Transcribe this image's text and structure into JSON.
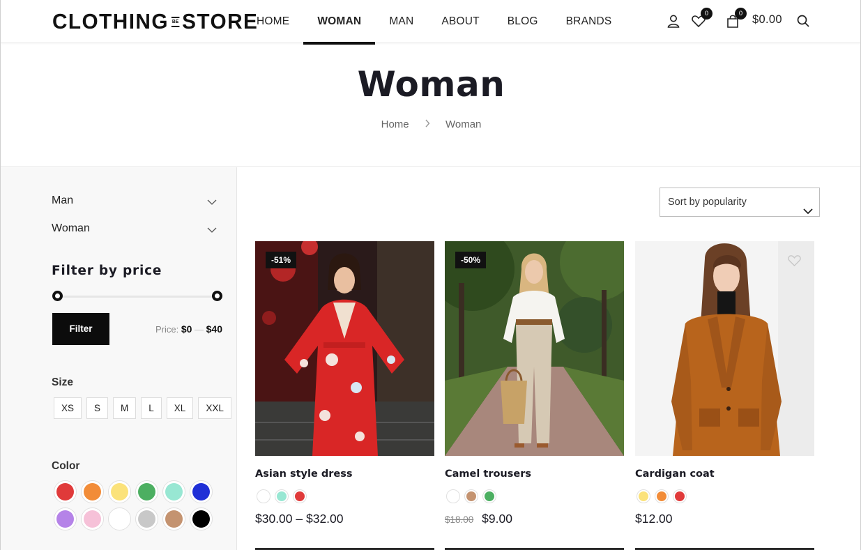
{
  "header": {
    "logo_left": "CLOTHING",
    "logo_mid": "BE",
    "logo_right": "STORE",
    "nav": [
      "HOME",
      "WOMAN",
      "MAN",
      "ABOUT",
      "BLOG",
      "BRANDS"
    ],
    "active_nav": "WOMAN",
    "icons": [
      "user-icon",
      "heart-icon",
      "cart-icon",
      "search-icon"
    ],
    "wishlist_count": "0",
    "cart_count": "0",
    "cart_total": "$0.00"
  },
  "page": {
    "title": "Woman",
    "breadcrumb": [
      "Home",
      "Woman"
    ]
  },
  "sidebar": {
    "categories": [
      "Man",
      "Woman"
    ],
    "price_heading": "Filter by price",
    "filter_label": "Filter",
    "price_prefix": "Price:",
    "price_min": "$0",
    "price_sep": "—",
    "price_max": "$40",
    "size_heading": "Size",
    "sizes": [
      "XS",
      "S",
      "M",
      "L",
      "XL",
      "XXL"
    ],
    "color_heading": "Color",
    "colors": [
      "#e03a3a",
      "#f28c38",
      "#fbe27a",
      "#4caf61",
      "#98e7d3",
      "#1f2fd6",
      "#b583e8",
      "#f6c1d8",
      "#ffffff",
      "#c8c8c8",
      "#c49370",
      "#000000"
    ]
  },
  "main": {
    "sort_label": "Sort by popularity",
    "products": [
      {
        "name": "Asian style dress",
        "sale": "-51%",
        "colors": [
          "#ffffff",
          "#98e7d3",
          "#e03a3a"
        ],
        "old_price": "",
        "price": "$30.00 – $32.00"
      },
      {
        "name": "Camel trousers",
        "sale": "-50%",
        "colors": [
          "#ffffff",
          "#c49370",
          "#4caf61"
        ],
        "old_price": "$18.00",
        "price": "$9.00"
      },
      {
        "name": "Cardigan coat",
        "sale": "",
        "colors": [
          "#fbe27a",
          "#f28c38",
          "#e03a3a"
        ],
        "old_price": "",
        "price": "$12.00"
      }
    ]
  }
}
